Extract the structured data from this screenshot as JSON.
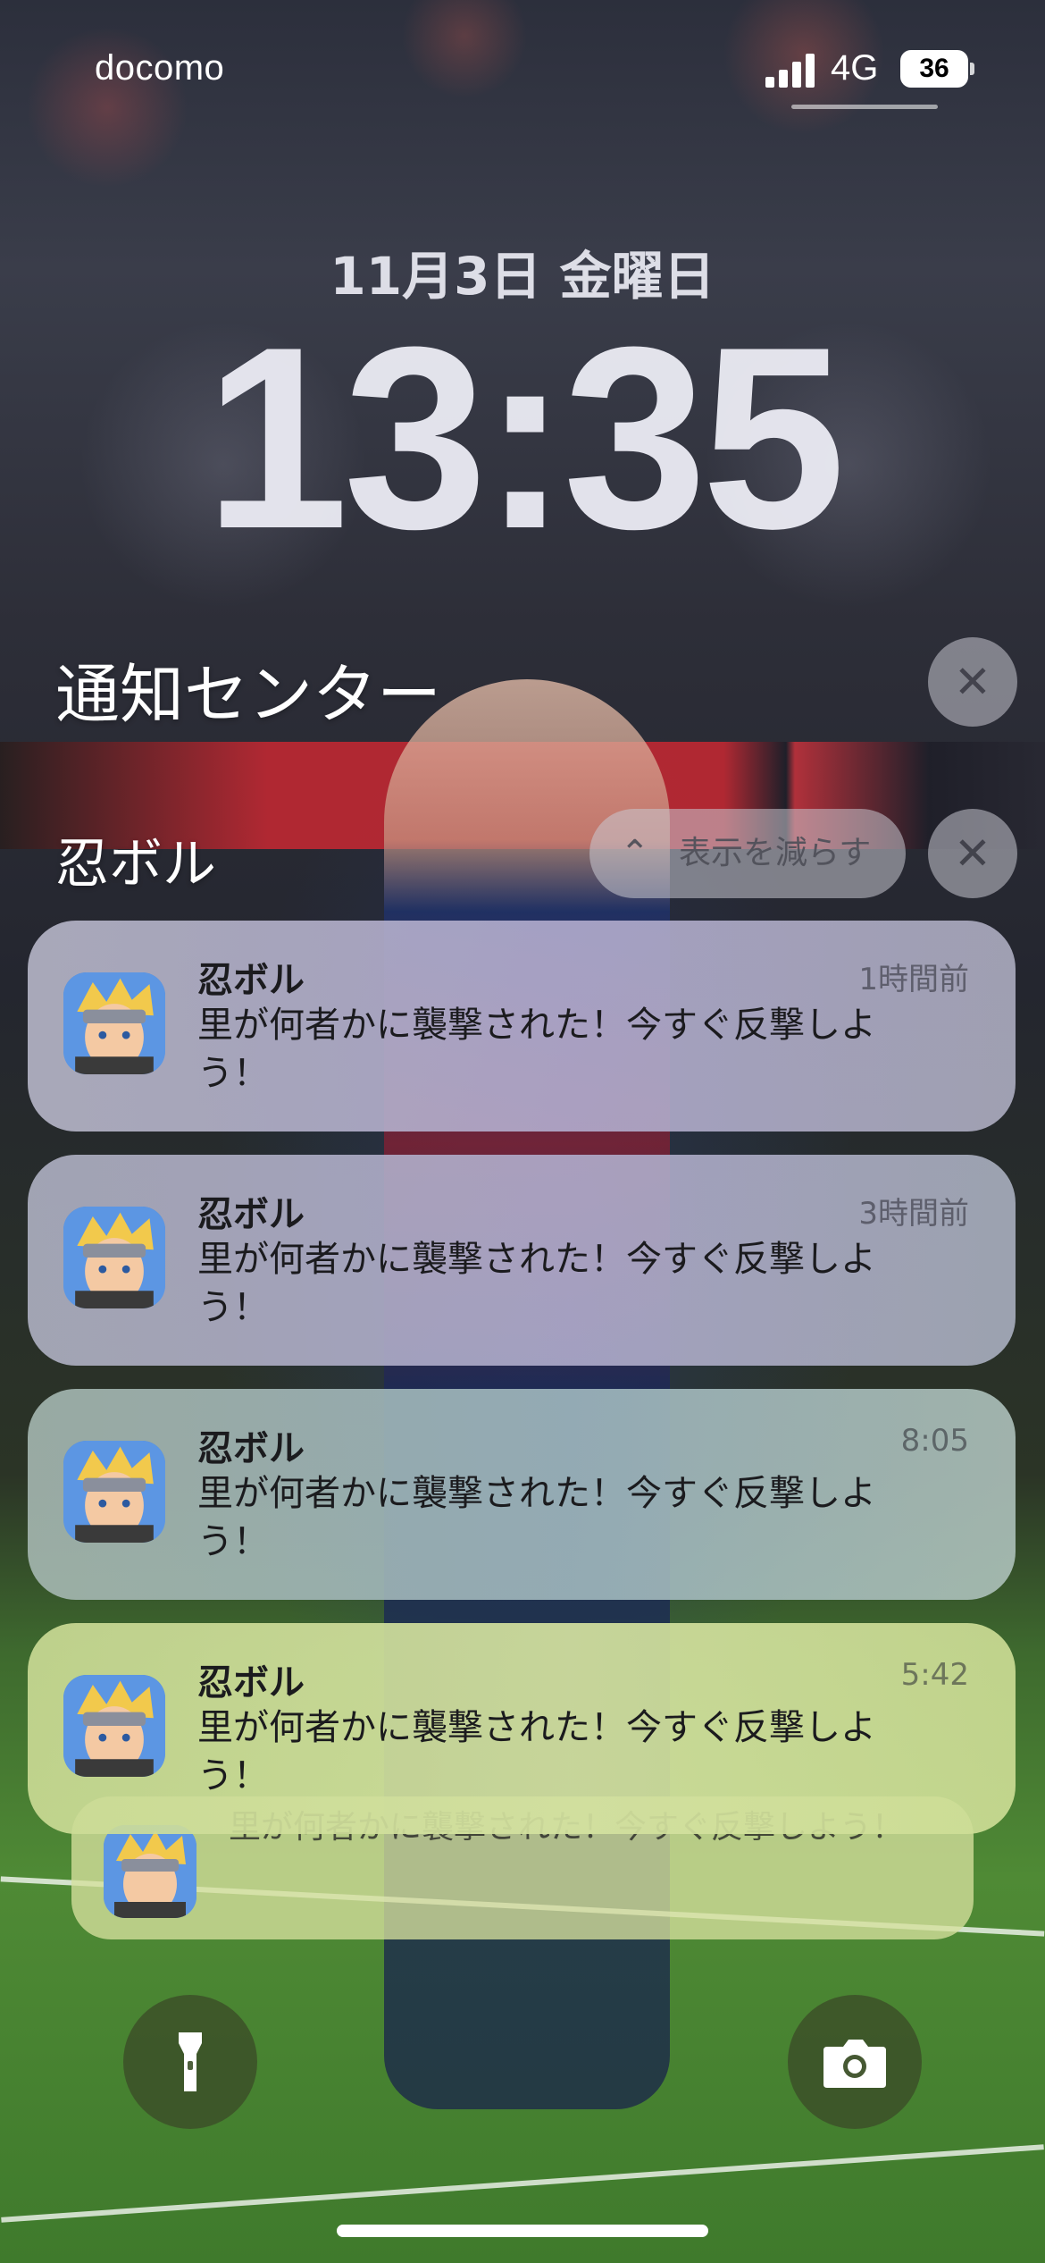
{
  "status_bar": {
    "carrier": "docomo",
    "network": "4G",
    "battery": "36"
  },
  "lock_screen": {
    "date": "11月3日 金曜日",
    "time": "13:35"
  },
  "notification_center": {
    "title": "通知センター",
    "clear_icon": "close-icon"
  },
  "group": {
    "app_name": "忍ボル",
    "show_less_label": "表示を減らす",
    "show_less_icon": "chevron-up-icon",
    "clear_icon": "close-icon"
  },
  "notifications": [
    {
      "app_name": "忍ボル",
      "time": "1時間前",
      "body": "里が何者かに襲撃された！今すぐ反撃しよう！"
    },
    {
      "app_name": "忍ボル",
      "time": "3時間前",
      "body": "里が何者かに襲撃された！今すぐ反撃しよう！"
    },
    {
      "app_name": "忍ボル",
      "time": "8:05",
      "body": "里が何者かに襲撃された！今すぐ反撃しよう！"
    },
    {
      "app_name": "忍ボル",
      "time": "5:42",
      "body": "里が何者かに襲撃された！今すぐ反撃しよう！"
    }
  ],
  "stacked_notification": {
    "body": "里が何者かに襲撃された！今すぐ反撃しよう！"
  },
  "controls": {
    "left": "flashlight-icon",
    "right": "camera-icon"
  }
}
